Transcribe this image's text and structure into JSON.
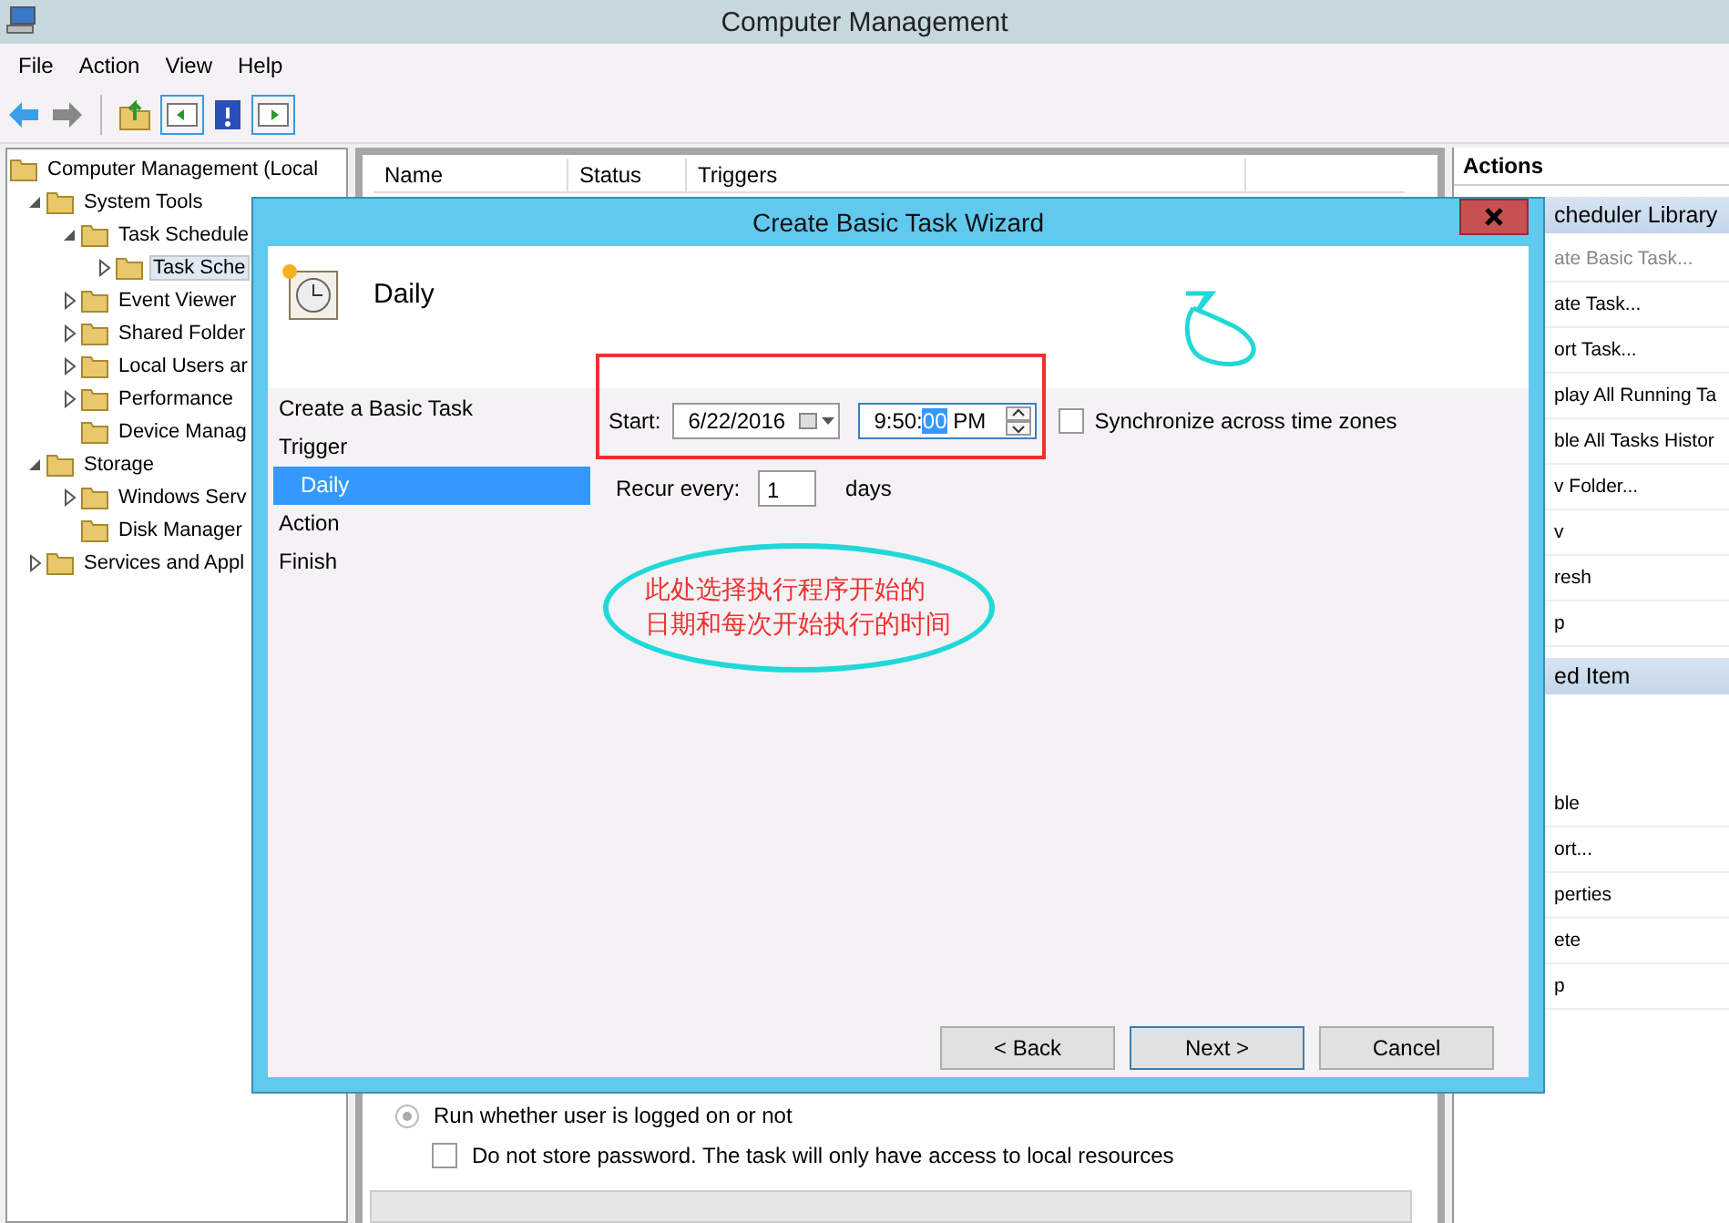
{
  "window": {
    "title": "Computer Management"
  },
  "menu": [
    "File",
    "Action",
    "View",
    "Help"
  ],
  "tree": [
    {
      "label": "Computer Management (Local",
      "selected": false,
      "children": [
        {
          "label": "System Tools",
          "expanded": true,
          "selected": false,
          "children": [
            {
              "label": "Task Schedule",
              "expanded": true,
              "selected": false,
              "children": [
                {
                  "label": "Task Sche",
                  "expanded": false,
                  "selected": true
                }
              ]
            },
            {
              "label": "Event Viewer",
              "expanded": false,
              "selected": false
            },
            {
              "label": "Shared Folder",
              "expanded": false,
              "selected": false
            },
            {
              "label": "Local Users ar",
              "expanded": false,
              "selected": false
            },
            {
              "label": "Performance",
              "expanded": false,
              "selected": false
            },
            {
              "label": "Device Manag",
              "selected": false
            }
          ]
        },
        {
          "label": "Storage",
          "expanded": true,
          "selected": false,
          "children": [
            {
              "label": "Windows Serv",
              "expanded": false,
              "selected": false
            },
            {
              "label": "Disk Manager",
              "selected": false
            }
          ]
        },
        {
          "label": "Services and Appl",
          "expanded": false,
          "selected": false
        }
      ]
    }
  ],
  "table": {
    "columns": [
      "Name",
      "Status",
      "Triggers"
    ]
  },
  "options": [
    {
      "kind": "radio",
      "label": "Run whether user is logged on or not",
      "checked": true
    },
    {
      "kind": "checkbox",
      "label": "Do not store password.  The task will only have access to local resources",
      "checked": false
    }
  ],
  "actions": {
    "title": "Actions",
    "sections": [
      {
        "title": "cheduler Library",
        "items": [
          {
            "label": "ate Basic Task...",
            "disabled": true
          },
          {
            "label": "ate Task...",
            "disabled": false
          },
          {
            "label": "ort Task...",
            "disabled": false
          },
          {
            "label": "play All Running Ta",
            "disabled": false
          },
          {
            "label": "ble All Tasks Histor",
            "disabled": false
          },
          {
            "label": "v Folder...",
            "disabled": false
          },
          {
            "label": "v",
            "disabled": false
          },
          {
            "label": "resh",
            "disabled": false
          },
          {
            "label": "p",
            "disabled": false
          }
        ]
      },
      {
        "title": "ed Item",
        "items": [
          {
            "label": "ble",
            "disabled": false
          },
          {
            "label": "ort...",
            "disabled": false
          },
          {
            "label": "perties",
            "disabled": false
          },
          {
            "label": "ete",
            "disabled": false
          },
          {
            "label": "p",
            "disabled": false
          }
        ]
      }
    ]
  },
  "dialog": {
    "title": "Create Basic Task Wizard",
    "heading": "Daily",
    "steps": [
      {
        "label": "Create a Basic Task",
        "selected": false
      },
      {
        "label": "Trigger",
        "selected": false,
        "children": [
          {
            "label": "Daily",
            "selected": true
          }
        ]
      },
      {
        "label": "Action",
        "selected": false
      },
      {
        "label": "Finish",
        "selected": false
      }
    ],
    "start": {
      "label": "Start:",
      "date": "6/22/2016",
      "time": {
        "hours_minutes": "9:50:",
        "seconds": "00",
        "ampm": "PM"
      }
    },
    "sync": {
      "label": "Synchronize across time zones",
      "checked": false
    },
    "recur": {
      "label": "Recur every:",
      "value": "1",
      "unit": "days"
    },
    "annotation": {
      "lines": [
        "此处选择执行程序开始的",
        "日期和每次开始执行的时间"
      ]
    },
    "buttons": [
      {
        "label": "< Back",
        "default": false
      },
      {
        "label": "Next >",
        "default": true
      },
      {
        "label": "Cancel",
        "default": false
      }
    ]
  }
}
